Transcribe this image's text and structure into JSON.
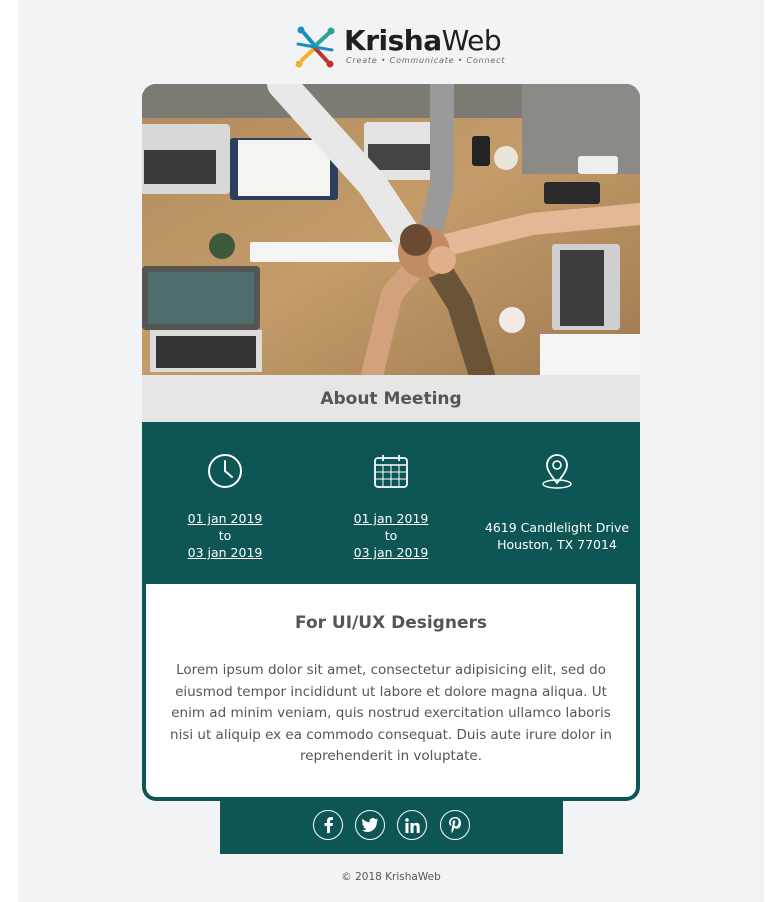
{
  "brand": {
    "name_bold": "Krisha",
    "name_light": "Web",
    "tagline": "Create • Communicate • Connect"
  },
  "hero": {
    "alt": "Team hands stacked over a table with laptops"
  },
  "about": {
    "title": "About Meeting"
  },
  "info": {
    "time": {
      "icon": "clock-icon",
      "from": "01 jan 2019",
      "to_word": "to",
      "to": "03 jan 2019"
    },
    "date": {
      "icon": "calendar-icon",
      "from": "01 jan 2019",
      "to_word": "to",
      "to": "03 jan 2019"
    },
    "location": {
      "icon": "map-pin-icon",
      "line1": "4619 Candlelight Drive",
      "line2": "Houston, TX 77014"
    }
  },
  "content": {
    "title": "For UI/UX Designers",
    "body": "Lorem ipsum dolor sit amet, consectetur adipisicing elit, sed do eiusmod tempor incididunt ut labore et dolore magna aliqua. Ut enim ad minim veniam, quis nostrud exercitation ullamco laboris nisi ut aliquip ex ea commodo consequat. Duis aute irure dolor in reprehenderit in voluptate."
  },
  "social": [
    {
      "icon": "facebook-icon",
      "glyph": "f"
    },
    {
      "icon": "twitter-icon",
      "glyph": "t"
    },
    {
      "icon": "linkedin-icon",
      "glyph": "in"
    },
    {
      "icon": "pinterest-icon",
      "glyph": "p"
    }
  ],
  "footer": {
    "copyright": "© 2018 KrishaWeb"
  },
  "colors": {
    "teal": "#0e5656",
    "page_bg": "#f2f3f5",
    "about_bg": "#e6e6e6",
    "text": "#555555"
  }
}
